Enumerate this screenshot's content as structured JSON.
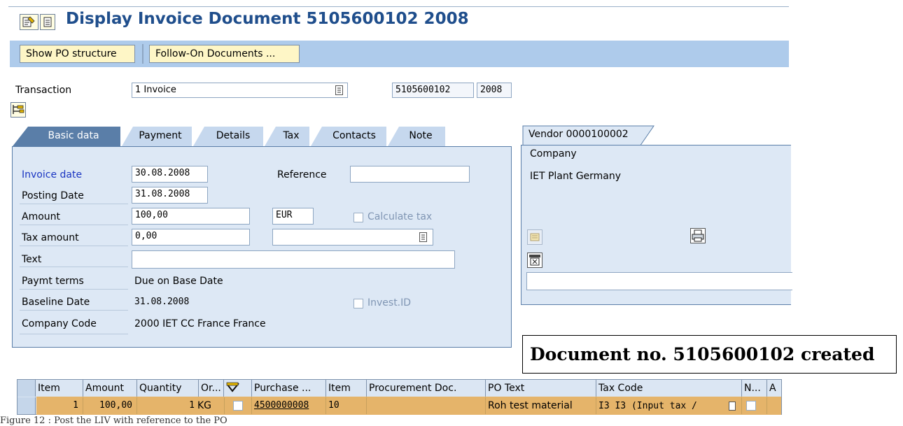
{
  "title": "Display Invoice Document 5105600102 2008",
  "toolbar": {
    "show_po_structure": "Show PO structure",
    "follow_on_documents": "Follow-On Documents ..."
  },
  "header": {
    "transaction_label": "Transaction",
    "transaction_value": "1 Invoice",
    "doc_number": "5105600102",
    "fiscal_year": "2008"
  },
  "tabs": [
    "Basic data",
    "Payment",
    "Details",
    "Tax",
    "Contacts",
    "Note"
  ],
  "basic": {
    "invoice_date_label": "Invoice date",
    "invoice_date": "30.08.2008",
    "reference_label": "Reference",
    "reference": "",
    "posting_date_label": "Posting Date",
    "posting_date": "31.08.2008",
    "amount_label": "Amount",
    "amount": "100,00",
    "currency": "EUR",
    "calculate_tax_label": "Calculate tax",
    "tax_amount_label": "Tax amount",
    "tax_amount": "0,00",
    "tax_code": "",
    "text_label": "Text",
    "text": "",
    "paymt_terms_label": "Paymt terms",
    "paymt_terms": "Due on Base Date",
    "baseline_date_label": "Baseline Date",
    "baseline_date": "31.08.2008",
    "invest_id_label": "Invest.ID",
    "company_code_label": "Company Code",
    "company_code": "2000 IET CC France France"
  },
  "vendor": {
    "tab_label": "Vendor 0000100002",
    "line1": "Company",
    "line2": "IET Plant Germany",
    "field": ""
  },
  "message": "Document no. 5105600102 created",
  "table": {
    "columns": [
      "Item",
      "Amount",
      "Quantity",
      "Or...",
      "",
      "Purchase ...",
      "Item",
      "Procurement Doc.",
      "PO Text",
      "Tax Code",
      "N...",
      "A"
    ],
    "row": {
      "item": "1",
      "amount": "100,00",
      "quantity": "1",
      "unit": "KG",
      "purchase": "4500000008",
      "po_item": "10",
      "procurement_doc": "",
      "po_text": "Roh test material",
      "tax_code": "I3 I3 (Input tax /"
    }
  },
  "caption": "Figure 12 : Post the LIV with reference to the PO",
  "colors": {
    "title_blue": "#1f4e8c",
    "toolbar_bg": "#aecbeb",
    "panel_bg": "#dde8f5",
    "row_highlight": "#e5b46a"
  }
}
